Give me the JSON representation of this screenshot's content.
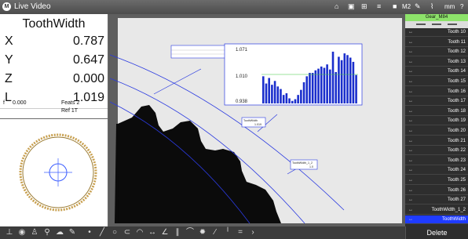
{
  "titlebar": {
    "app_title": "Live Video",
    "mode": "M2",
    "units": "mm",
    "help": "?"
  },
  "readout": {
    "feature_name": "ToothWidth",
    "rows": [
      {
        "label": "X",
        "value": "0.787"
      },
      {
        "label": "Y",
        "value": "0.647"
      },
      {
        "label": "Z",
        "value": "0.000"
      },
      {
        "label": "L",
        "value": "1.019"
      }
    ],
    "f_label": "f",
    "f_value": "0.000",
    "feats": "Feats 2",
    "ref": "Ref 1T"
  },
  "overlay": {
    "chart_y_top": "1.071",
    "chart_y_mid": "1.010",
    "chart_y_bot": "0.938",
    "box1_label": "ToothWidth",
    "box1_val": "1.019",
    "box2_label": "ToothWidth_1_2",
    "box2_val": "1.0"
  },
  "chart_data": {
    "type": "bar",
    "ylim": [
      0.938,
      1.071
    ],
    "reference": 1.01,
    "values": [
      1.002,
      0.985,
      0.998,
      0.982,
      0.991,
      0.978,
      0.972,
      0.958,
      0.962,
      0.95,
      0.944,
      0.948,
      0.958,
      0.97,
      0.988,
      1.002,
      1.01,
      1.01,
      1.016,
      1.02,
      1.025,
      1.022,
      1.03,
      1.018,
      1.06,
      1.012,
      1.048,
      1.04,
      1.056,
      1.052,
      1.046,
      1.036,
      1.005
    ]
  },
  "feature_list": {
    "header": "Gear_M84",
    "items": [
      "Tooth 10",
      "Tooth 11",
      "Tooth 12",
      "Tooth 13",
      "Tooth 14",
      "Tooth 15",
      "Tooth 16",
      "Tooth 17",
      "Tooth 18",
      "Tooth 19",
      "Tooth 20",
      "Tooth 21",
      "Tooth 22",
      "Tooth 23",
      "Tooth 24",
      "Tooth 25",
      "Tooth 26",
      "Tooth 27",
      "ToothWidth_1_2",
      "ToothWidth"
    ],
    "selected": "ToothWidth",
    "delete_label": "Delete"
  },
  "colors": {
    "selection": "#1f3bff",
    "chart_bar": "#1a2ecc",
    "overlay_line": "#2a3ae0",
    "list_header": "#8de36a"
  }
}
